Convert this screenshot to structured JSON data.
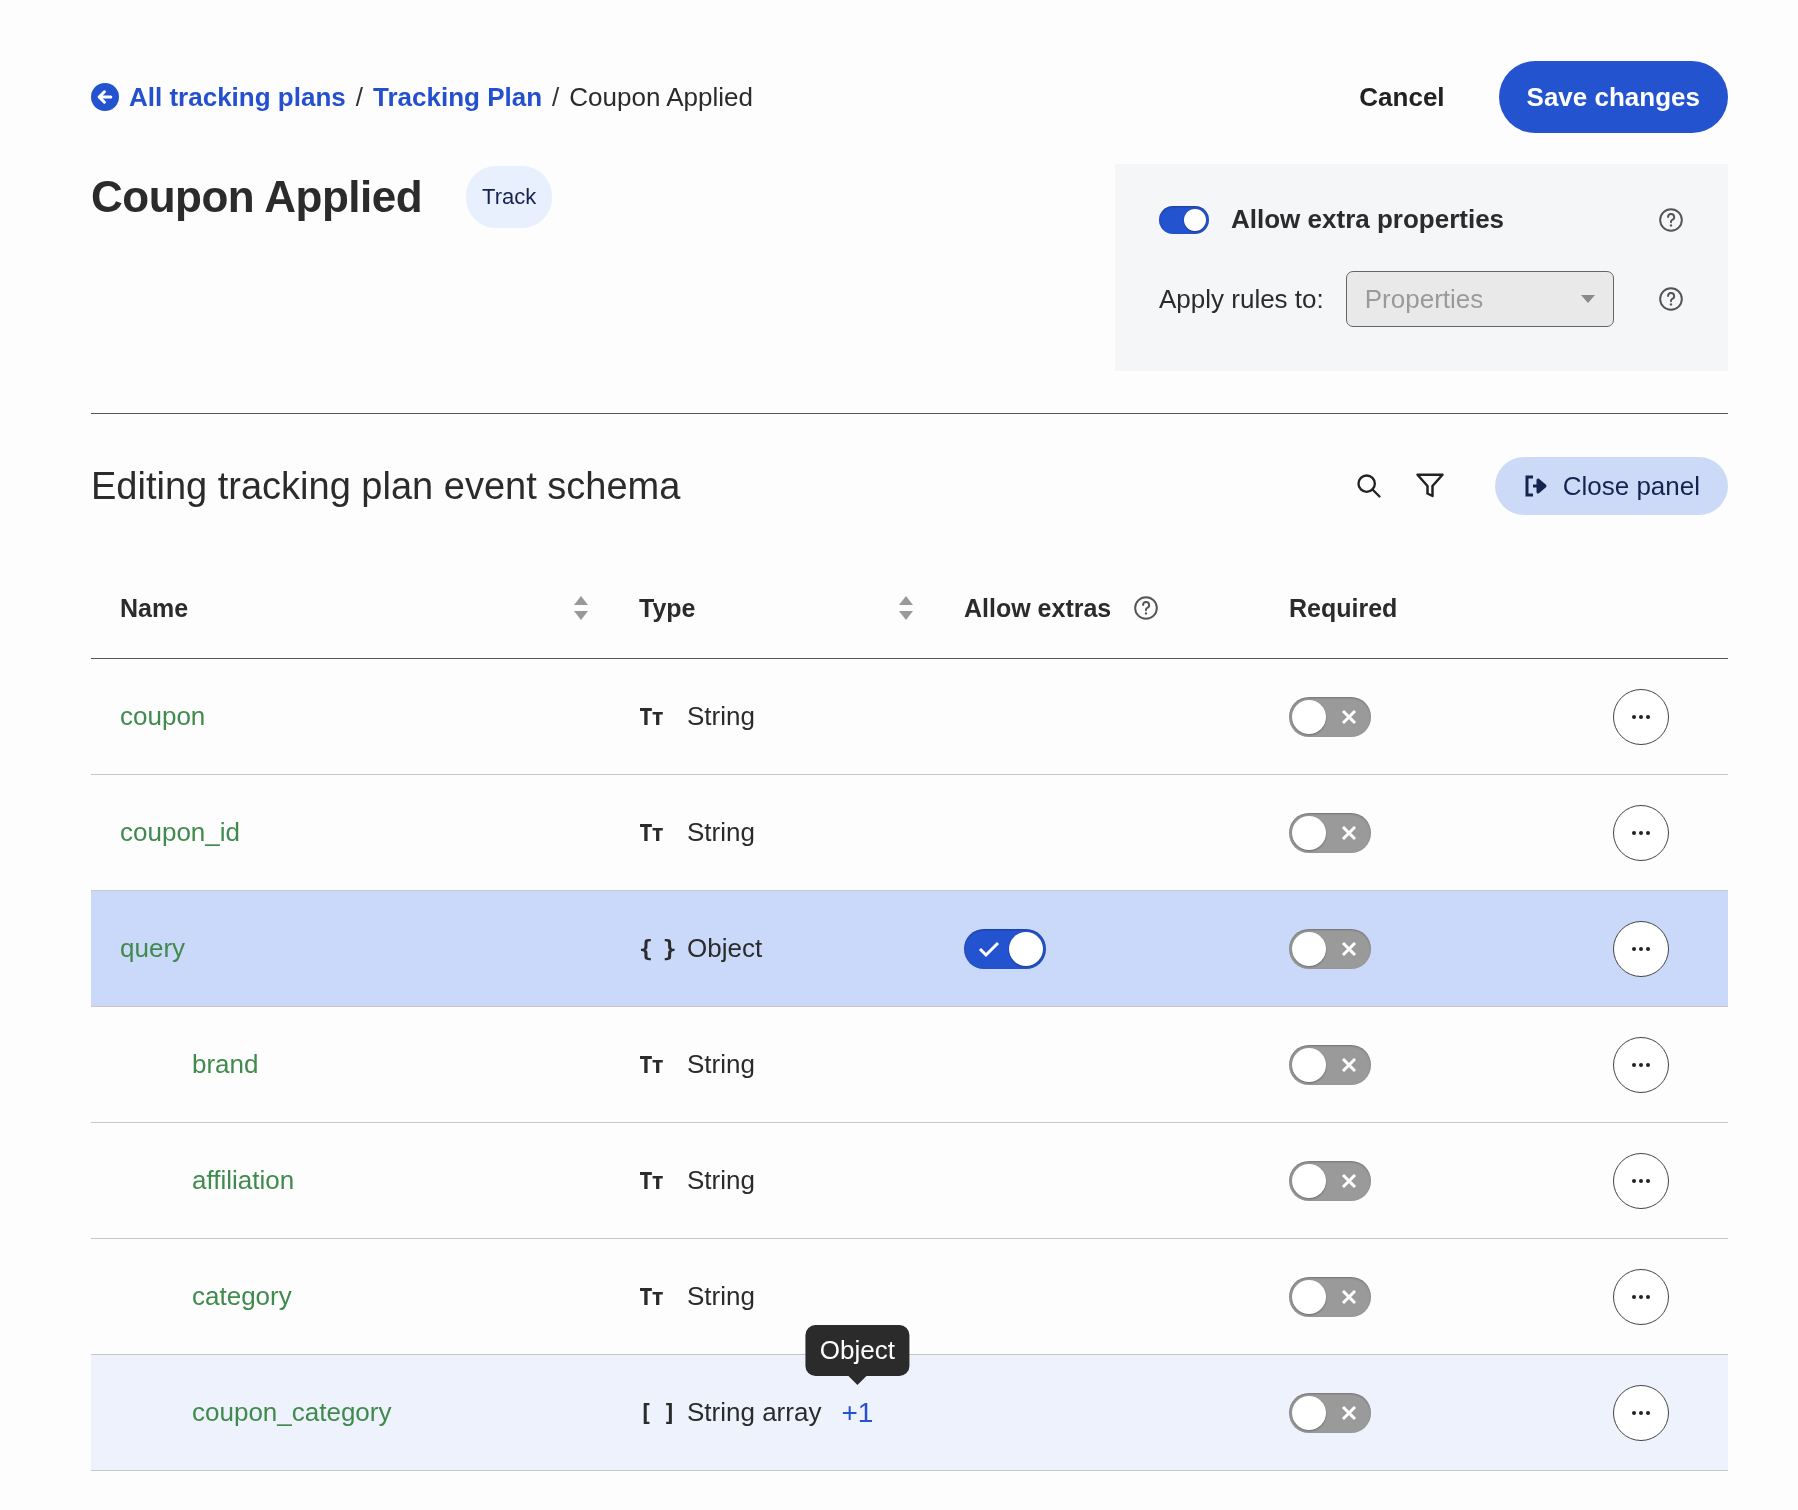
{
  "breadcrumb": {
    "links": [
      "All tracking plans",
      "Tracking Plan"
    ],
    "separators": [
      "/",
      "/"
    ],
    "current": "Coupon Applied"
  },
  "actions": {
    "cancel": "Cancel",
    "save": "Save changes"
  },
  "event": {
    "title": "Coupon Applied",
    "badge": "Track"
  },
  "settings": {
    "allow_extra": {
      "label": "Allow extra properties",
      "on": true
    },
    "apply_rules": {
      "label": "Apply rules to:",
      "placeholder": "Properties"
    }
  },
  "schema": {
    "title": "Editing tracking plan event schema",
    "close_panel": "Close panel",
    "columns": [
      {
        "label": "Name",
        "sortable": true,
        "help": false
      },
      {
        "label": "Type",
        "sortable": true,
        "help": false
      },
      {
        "label": "Allow extras",
        "sortable": false,
        "help": true
      },
      {
        "label": "Required",
        "sortable": false,
        "help": false
      }
    ],
    "rows": [
      {
        "name": "coupon",
        "type_icon": "Tт",
        "type": "String",
        "required": false,
        "selected": false,
        "hovered": false
      },
      {
        "name": "coupon_id",
        "type_icon": "Tт",
        "type": "String",
        "required": false,
        "selected": false,
        "hovered": false
      },
      {
        "name": "query",
        "type_icon": "{ }",
        "type": "Object",
        "allow_extras": true,
        "required": false,
        "selected": true,
        "hovered": false,
        "children": [
          {
            "name": "brand",
            "type_icon": "Tт",
            "type": "String",
            "required": false,
            "selected": false,
            "hovered": false
          },
          {
            "name": "affiliation",
            "type_icon": "Tт",
            "type": "String",
            "required": false,
            "selected": false,
            "hovered": false
          },
          {
            "name": "category",
            "type_icon": "Tт",
            "type": "String",
            "required": false,
            "selected": false,
            "hovered": false
          },
          {
            "name": "coupon_category",
            "type_icon": "[ ]",
            "type": "String array",
            "more_types": "+1",
            "tooltip": "Object",
            "required": false,
            "selected": false,
            "hovered": true
          }
        ]
      }
    ]
  }
}
